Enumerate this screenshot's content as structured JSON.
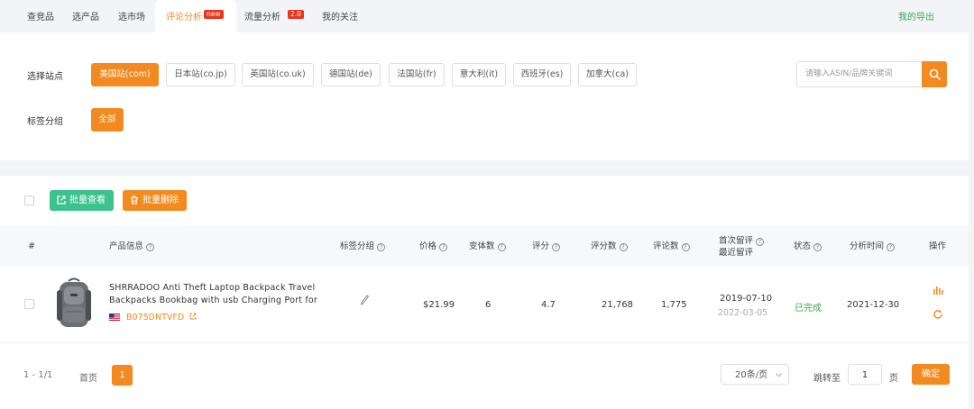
{
  "nav": {
    "tabs": [
      {
        "label": "查竞品"
      },
      {
        "label": "选产品"
      },
      {
        "label": "选市场"
      },
      {
        "label": "评论分析",
        "badge": "new"
      },
      {
        "label": "流量分析",
        "badge": "2.0"
      },
      {
        "label": "我的关注"
      }
    ],
    "export_label": "我的导出"
  },
  "filter": {
    "site_label": "选择站点",
    "sites": [
      "美国站(com)",
      "日本站(co.jp)",
      "英国站(co.uk)",
      "德国站(de)",
      "法国站(fr)",
      "意大利(it)",
      "西班牙(es)",
      "加拿大(ca)"
    ],
    "tag_label": "标签分组",
    "tag_all": "全部",
    "search_placeholder": "请输入ASIN/品牌关键词"
  },
  "actions": {
    "batch_view": "批量查看",
    "batch_delete": "批量删除"
  },
  "table": {
    "headers": {
      "index": "#",
      "product": "产品信息",
      "tag": "标签分组",
      "price": "价格",
      "variants": "变体数",
      "rating": "评分",
      "rating_count": "评分数",
      "review_count": "评论数",
      "first_review": "首次留评",
      "last_review": "最近留评",
      "status": "状态",
      "analysis_time": "分析时间",
      "ops": "操作"
    },
    "rows": [
      {
        "title": "SHRRADOO Anti Theft Laptop Backpack Travel Backpacks Bookbag with usb Charging Port for ...",
        "asin": "B075DNTVFD",
        "price": "$21.99",
        "variants": "6",
        "rating": "4.7",
        "rating_count": "21,768",
        "review_count": "1,775",
        "first_review": "2019-07-10",
        "last_review": "2022-03-05",
        "status": "已完成",
        "analysis_time": "2021-12-30"
      }
    ]
  },
  "pagination": {
    "range": "1 - 1/1",
    "first": "首页",
    "current": "1",
    "page_size": "20条/页",
    "jump_label": "跳转至",
    "jump_value": "1",
    "page_unit": "页",
    "confirm": "确定"
  },
  "colors": {
    "accent": "#f38a1f",
    "green": "#3cc28d",
    "status_done": "#3aa653",
    "badge": "#e8361f"
  }
}
